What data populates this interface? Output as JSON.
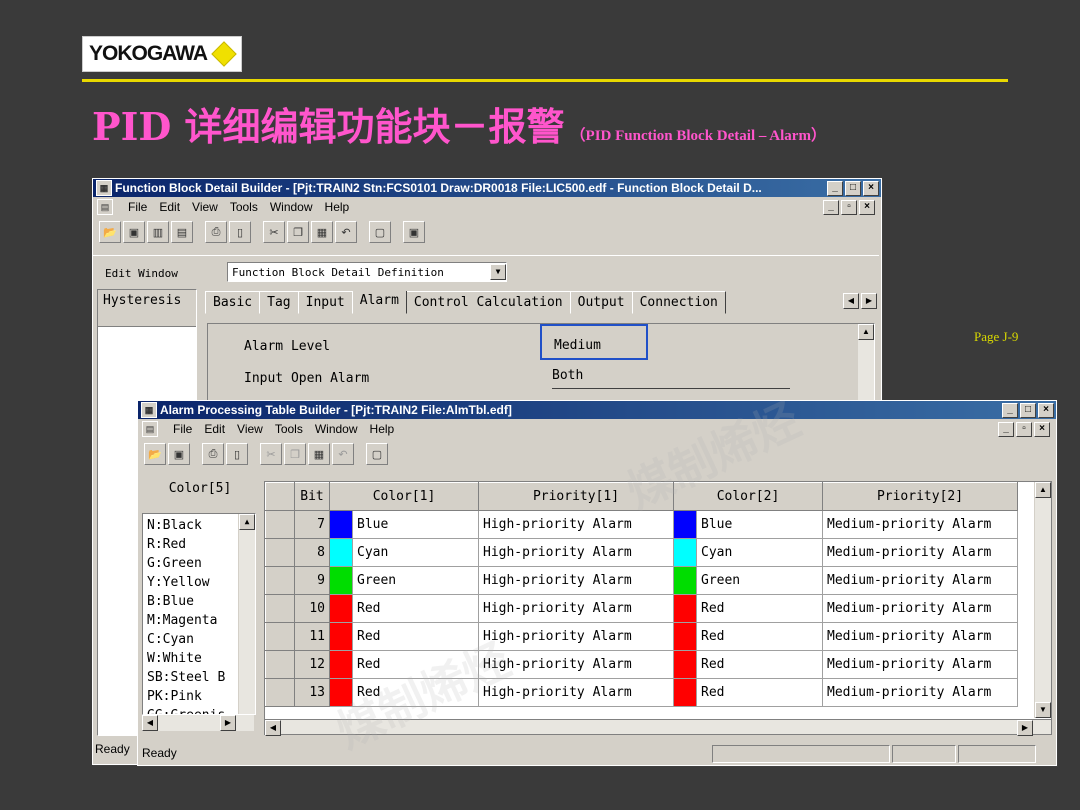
{
  "logo": {
    "text": "YOKOGAWA"
  },
  "slide": {
    "title": "PID 详细编辑功能块－报警",
    "subtitle": "（PID Function Block Detail – Alarm）",
    "page_number": "Page J-9"
  },
  "colors": {
    "accent": "#ff55cc",
    "rule": "#e8d800",
    "titlebar": "#0a246a"
  },
  "watermark": "煤制烯烃",
  "fbdb": {
    "title": "Function Block Detail Builder - [Pjt:TRAIN2 Stn:FCS0101 Draw:DR0018 File:LIC500.edf - Function Block Detail D...",
    "menu": [
      "File",
      "Edit",
      "View",
      "Tools",
      "Window",
      "Help"
    ],
    "edit_window_label": "Edit Window",
    "edit_window_value": "Function Block Detail Definition",
    "side_item": "Hysteresis",
    "tabs": [
      "Basic",
      "Tag",
      "Input",
      "Alarm",
      "Control Calculation",
      "Output",
      "Connection"
    ],
    "active_tab": "Alarm",
    "fields": [
      {
        "label": "Alarm Level",
        "value": "Medium"
      },
      {
        "label": "Input Open Alarm",
        "value": "Both"
      }
    ],
    "status": "Ready"
  },
  "aptb": {
    "title": "Alarm Processing Table Builder - [Pjt:TRAIN2 File:AlmTbl.edf]",
    "menu": [
      "File",
      "Edit",
      "View",
      "Tools",
      "Window",
      "Help"
    ],
    "list_header": "Color[5]",
    "list_items": [
      "N:Black",
      "R:Red",
      "G:Green",
      "Y:Yellow",
      "B:Blue",
      "M:Magenta",
      "C:Cyan",
      "W:White",
      "SB:Steel B",
      "PK:Pink",
      "GG:Greenis"
    ],
    "columns": [
      "Bit",
      "Color[1]",
      "Priority[1]",
      "Color[2]",
      "Priority[2]"
    ],
    "rows": [
      {
        "bit": "7",
        "c1": "Blue",
        "sw1": "#0000ff",
        "p1": "High-priority Alarm",
        "c2": "Blue",
        "sw2": "#0000ff",
        "p2": "Medium-priority Alarm"
      },
      {
        "bit": "8",
        "c1": "Cyan",
        "sw1": "#00ffff",
        "p1": "High-priority Alarm",
        "c2": "Cyan",
        "sw2": "#00ffff",
        "p2": "Medium-priority Alarm"
      },
      {
        "bit": "9",
        "c1": "Green",
        "sw1": "#00dd00",
        "p1": "High-priority Alarm",
        "c2": "Green",
        "sw2": "#00dd00",
        "p2": "Medium-priority Alarm"
      },
      {
        "bit": "10",
        "c1": "Red",
        "sw1": "#ff0000",
        "p1": "High-priority Alarm",
        "c2": "Red",
        "sw2": "#ff0000",
        "p2": "Medium-priority Alarm"
      },
      {
        "bit": "11",
        "c1": "Red",
        "sw1": "#ff0000",
        "p1": "High-priority Alarm",
        "c2": "Red",
        "sw2": "#ff0000",
        "p2": "Medium-priority Alarm"
      },
      {
        "bit": "12",
        "c1": "Red",
        "sw1": "#ff0000",
        "p1": "High-priority Alarm",
        "c2": "Red",
        "sw2": "#ff0000",
        "p2": "Medium-priority Alarm"
      },
      {
        "bit": "13",
        "c1": "Red",
        "sw1": "#ff0000",
        "p1": "High-priority Alarm",
        "c2": "Red",
        "sw2": "#ff0000",
        "p2": "Medium-priority Alarm"
      }
    ],
    "status": "Ready"
  }
}
